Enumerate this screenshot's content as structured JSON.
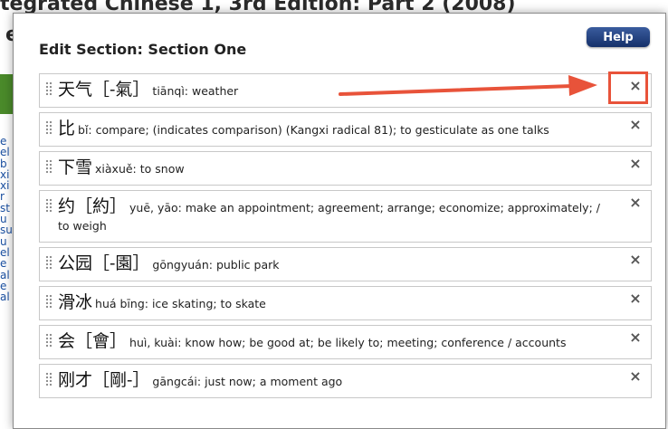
{
  "background": {
    "title": "tegrated Chinese 1, 3rd Edition: Part 2 (2008)",
    "second_line": "e",
    "side_links": [
      "e",
      "el",
      "b",
      "xi",
      "xi",
      "r",
      "st",
      "u",
      "su",
      "u",
      "el",
      "e",
      "al",
      "e",
      "al"
    ]
  },
  "modal": {
    "title": "Edit Section: Section One",
    "help_label": "Help",
    "items": [
      {
        "hanzi": "天气［-氣］",
        "text": "tiānqì: weather"
      },
      {
        "hanzi": "比",
        "text": "bǐ: compare; (indicates comparison) (Kangxi radical 81); to gesticulate as one talks"
      },
      {
        "hanzi": "下雪",
        "text": "xiàxuě: to snow"
      },
      {
        "hanzi": "约［約］",
        "text": "yuē, yāo: make an appointment; agreement; arrange; economize; approximately; / to weigh"
      },
      {
        "hanzi": "公园［-園］",
        "text": "gōngyuán: public park"
      },
      {
        "hanzi": "滑冰",
        "text": "huá bīng: ice skating; to skate"
      },
      {
        "hanzi": "会［會］",
        "text": "huì, kuài: know how; be good at; be likely to; meeting; conference / accounts"
      },
      {
        "hanzi": "刚才［剛-］",
        "text": "gāngcái: just now; a moment ago"
      }
    ],
    "close_icon": "×"
  },
  "colors": {
    "annotation": "#e8533a",
    "help_button": "#1f3d7a"
  }
}
